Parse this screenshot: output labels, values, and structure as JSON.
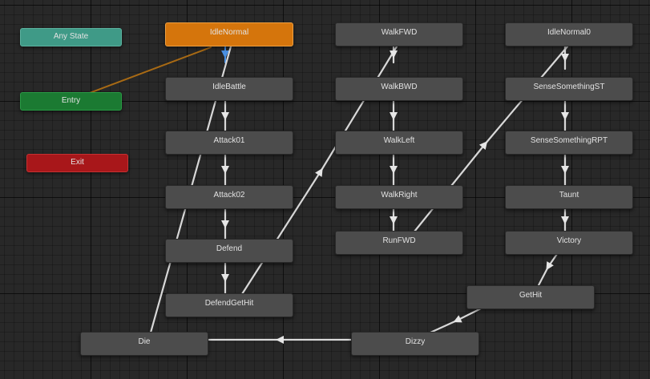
{
  "graph": {
    "states": {
      "any_state": "Any State",
      "entry": "Entry",
      "exit": "Exit",
      "idle_normal": "IdleNormal",
      "idle_battle": "IdleBattle",
      "attack01": "Attack01",
      "attack02": "Attack02",
      "defend": "Defend",
      "defend_get_hit": "DefendGetHit",
      "die": "Die",
      "walk_fwd": "WalkFWD",
      "walk_bwd": "WalkBWD",
      "walk_left": "WalkLeft",
      "walk_right": "WalkRight",
      "run_fwd": "RunFWD",
      "idle_normal0": "IdleNormal0",
      "sense_something_st": "SenseSomethingST",
      "sense_something_rpt": "SenseSomethingRPT",
      "taunt": "Taunt",
      "victory": "Victory",
      "get_hit": "GetHit",
      "dizzy": "Dizzy"
    },
    "colors": {
      "default_state": "#d5750c",
      "any_state": "#3f9a87",
      "entry": "#1b7a32",
      "exit": "#a8171a",
      "state": "#4c4c4c",
      "transition": "#d8d8d8",
      "entry_transition": "#a86a14",
      "selected_transition": "#4a90e2"
    }
  }
}
